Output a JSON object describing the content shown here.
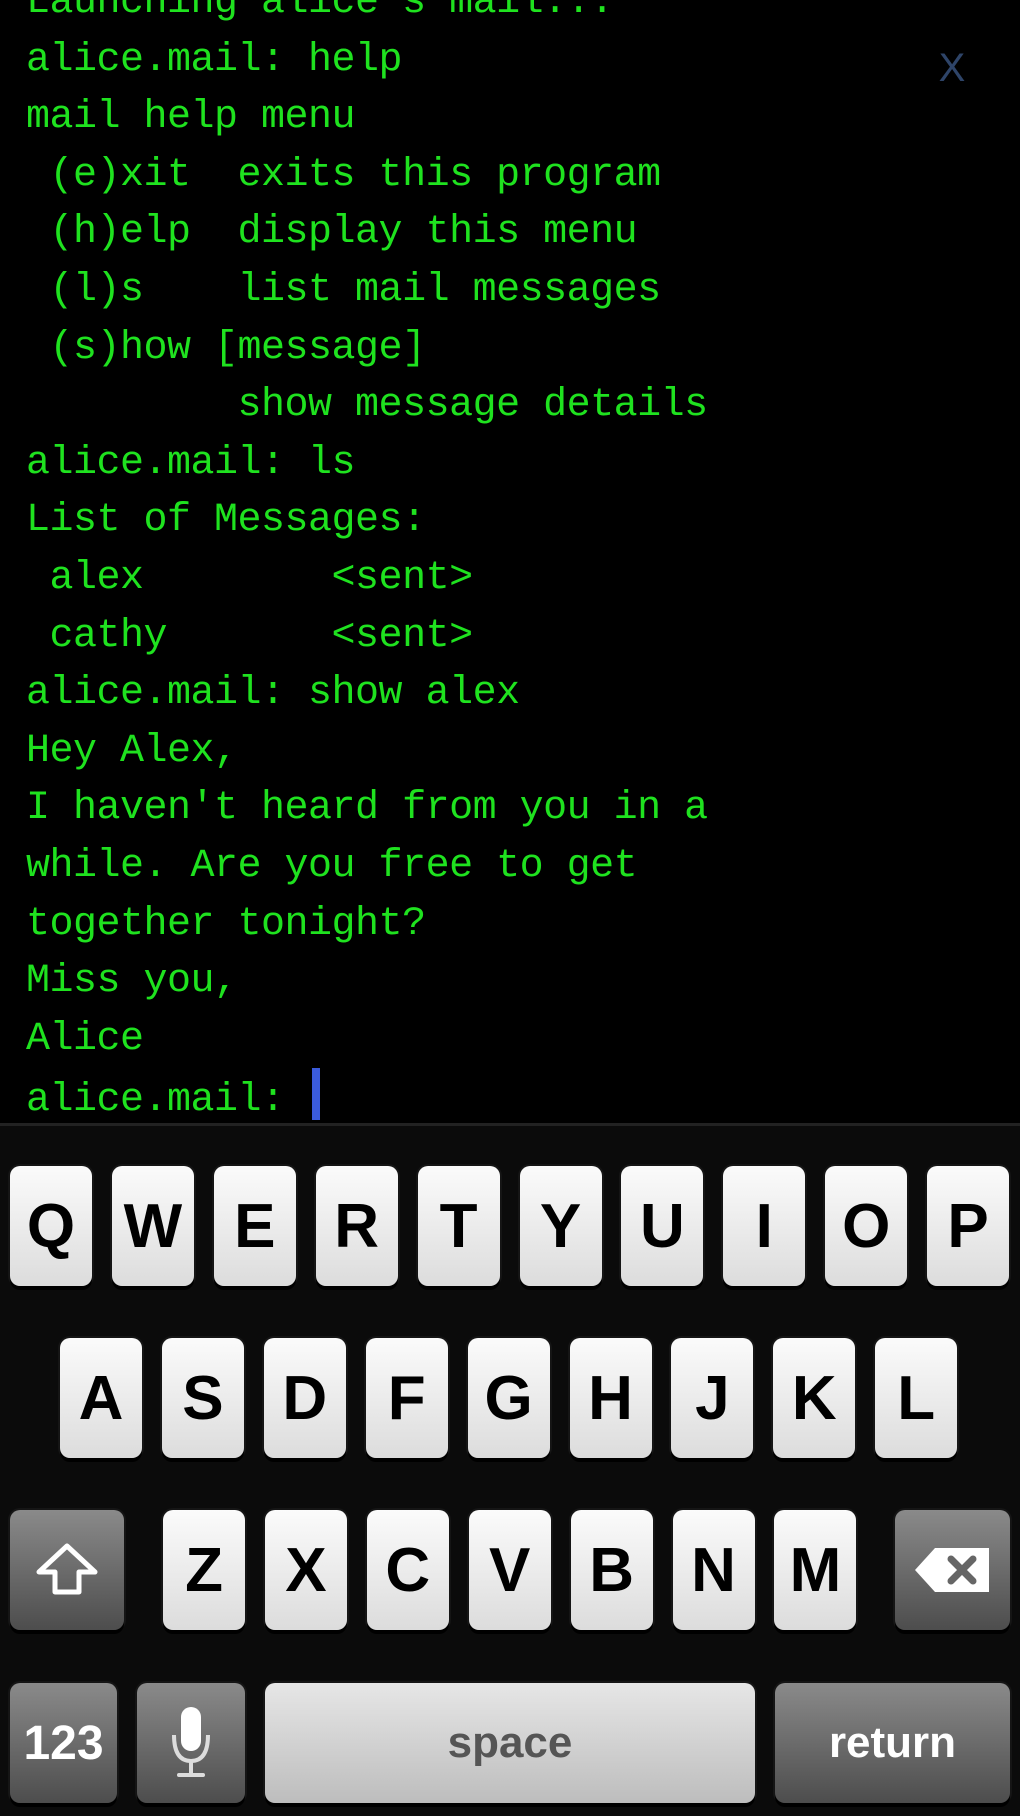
{
  "terminal": {
    "lines": [
      "Launching alice's mail...",
      "alice.mail: help",
      "mail help menu",
      " (e)xit  exits this program",
      " (h)elp  display this menu",
      " (l)s    list mail messages",
      " (s)how [message]",
      "         show message details",
      "alice.mail: ls",
      "List of Messages:",
      " alex        <sent>",
      " cathy       <sent>",
      "alice.mail: show alex",
      "Hey Alex,",
      "I haven't heard from you in a",
      "while. Are you free to get",
      "together tonight?",
      "Miss you,",
      "Alice"
    ],
    "prompt": "alice.mail: ",
    "input_value": "",
    "close_label": "X",
    "text_color": "#1fe21f",
    "cursor_color": "#3b5bdb"
  },
  "keyboard": {
    "row1": [
      "Q",
      "W",
      "E",
      "R",
      "T",
      "Y",
      "U",
      "I",
      "O",
      "P"
    ],
    "row2": [
      "A",
      "S",
      "D",
      "F",
      "G",
      "H",
      "J",
      "K",
      "L"
    ],
    "row3": [
      "Z",
      "X",
      "C",
      "V",
      "B",
      "N",
      "M"
    ],
    "shift_icon": "shift-arrow-up",
    "delete_icon": "backspace",
    "numbers_label": "123",
    "mic_icon": "microphone",
    "space_label": "space",
    "return_label": "return"
  }
}
